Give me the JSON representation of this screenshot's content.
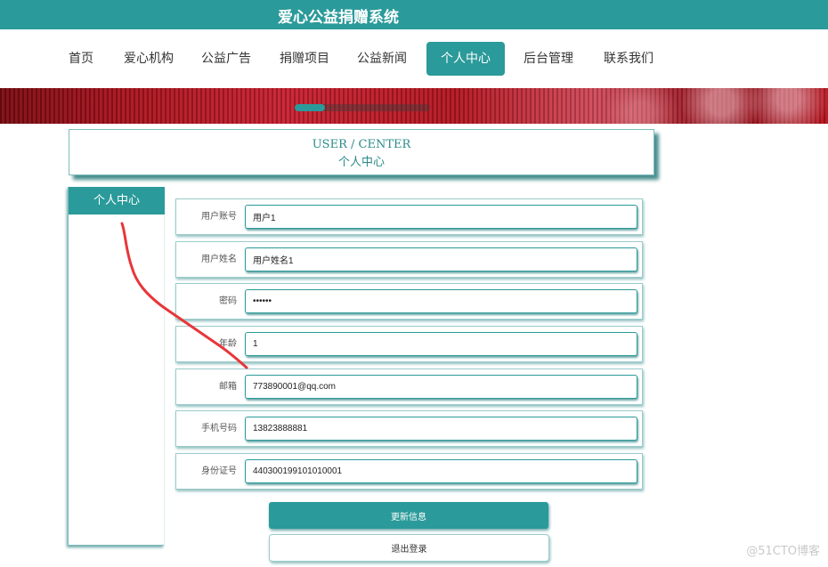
{
  "header": {
    "site_title": "爱心公益捐赠系统",
    "accent_color": "#2b9a9a"
  },
  "nav": {
    "items": [
      {
        "label": "首页"
      },
      {
        "label": "爱心机构"
      },
      {
        "label": "公益广告"
      },
      {
        "label": "捐赠项目"
      },
      {
        "label": "公益新闻"
      },
      {
        "label": "个人中心",
        "active": true
      },
      {
        "label": "后台管理"
      },
      {
        "label": "联系我们"
      }
    ]
  },
  "banner": {
    "carousel_position": 1
  },
  "page_title": {
    "en": "USER / CENTER",
    "zh": "个人中心"
  },
  "sidebar": {
    "heading": "个人中心"
  },
  "form": {
    "fields": [
      {
        "label": "用户账号",
        "value": "用户1",
        "type": "text"
      },
      {
        "label": "用户姓名",
        "value": "用户姓名1",
        "type": "text"
      },
      {
        "label": "密码",
        "value": "123456",
        "type": "password"
      },
      {
        "label": "年龄",
        "value": "1",
        "type": "text"
      },
      {
        "label": "邮箱",
        "value": "773890001@qq.com",
        "type": "text"
      },
      {
        "label": "手机号码",
        "value": "13823888881",
        "type": "text"
      },
      {
        "label": "身份证号",
        "value": "440300199101010001",
        "type": "text"
      }
    ],
    "update_button": "更新信息",
    "logout_button": "退出登录"
  },
  "annotation": {
    "color": "#e8363a"
  },
  "watermark": "@51CTO博客"
}
